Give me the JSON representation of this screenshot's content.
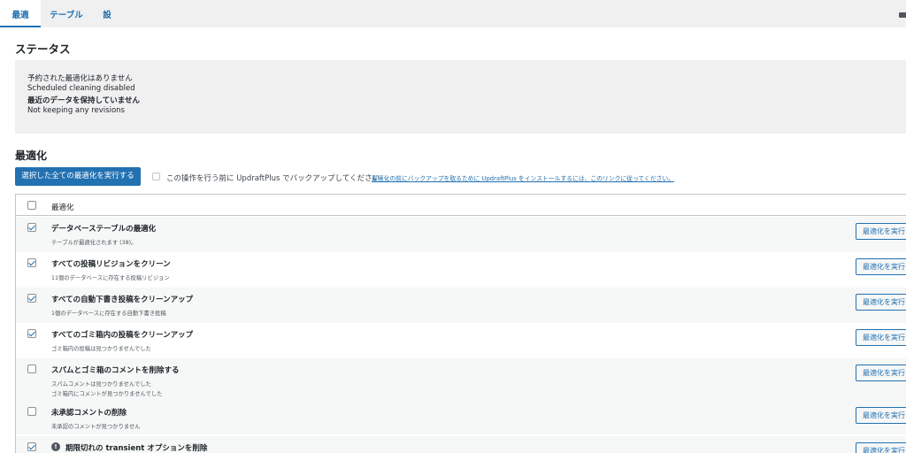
{
  "tabs": [
    {
      "label": "最適化",
      "active": true
    },
    {
      "label": "テーブル",
      "active": false
    },
    {
      "label": "設定",
      "active": false
    }
  ],
  "status": {
    "heading": "ステータス",
    "lines": [
      "予約された最適化はありません",
      "Scheduled cleaning disabled",
      "最近のデータを保持していません",
      "Not keeping any revisions"
    ]
  },
  "optimizations": {
    "heading": "最適化",
    "run_all_label": "選択した全ての最適化を実行する",
    "backup_text": "この操作を行う前に UpdraftPlus でバックアップしてください",
    "backup_link": "最適化の前にバックアップを取るために UpdraftPlus をインストールするには、このリンクに従ってください。",
    "column_header": "最適化",
    "rows": [
      {
        "title": "データベーステーブルの最適化",
        "desc": [
          "テーブルが最適化されます (38)。"
        ],
        "checked": true,
        "button": "最適化を実行"
      },
      {
        "title": "すべての投稿リビジョンをクリーン",
        "desc": [
          "11個のデータベースに存在する投稿リビジョン"
        ],
        "checked": true,
        "button": "最適化を実行"
      },
      {
        "title": "すべての自動下書き投稿をクリーンアップ",
        "desc": [
          "1個のデータベースに存在する自動下書き投稿"
        ],
        "checked": true,
        "button": "最適化を実行"
      },
      {
        "title": "すべてのゴミ箱内の投稿をクリーンアップ",
        "desc": [
          "ゴミ箱内の投稿は見つかりませんでした"
        ],
        "checked": true,
        "button": "最適化を実行"
      },
      {
        "title": "スパムとゴミ箱のコメントを削除する",
        "desc": [
          "スパムコメントは見つかりませんでした",
          "ゴミ箱内にコメントが見つかりませんでした"
        ],
        "checked": false,
        "button": "最適化を実行"
      },
      {
        "title": "未承認コメントの削除",
        "desc": [
          "未承認のコメントが見つかりません"
        ],
        "checked": false,
        "button": "最適化を実行"
      },
      {
        "title": "期限切れの transient オプションを削除",
        "desc": [],
        "checked": true,
        "button": "最適化を実行"
      }
    ]
  }
}
